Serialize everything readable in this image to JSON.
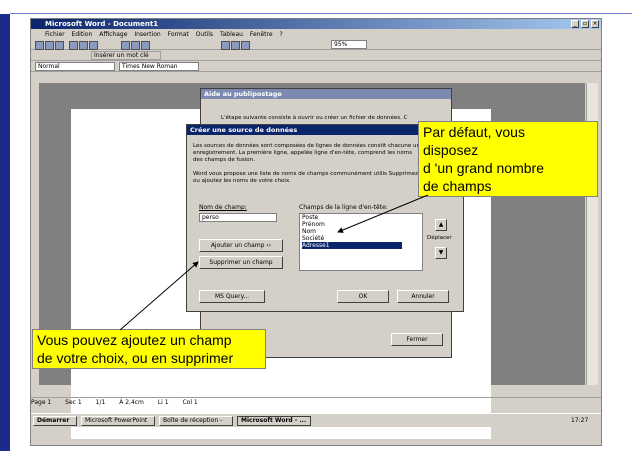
{
  "window": {
    "title": "Microsoft Word - Document1",
    "menu": [
      "Fichier",
      "Edition",
      "Affichage",
      "Insertion",
      "Format",
      "Outils",
      "Tableau",
      "Fenêtre",
      "?"
    ],
    "zoom": "95%",
    "style_value": "Normal",
    "font_value": "Times New Roman",
    "insert_field_label": "Insérer un mot clé"
  },
  "back_dialog": {
    "title": "Aide au publipostage",
    "text": "L'étape suivante consiste à ouvrir ou créer un fichier de données. C",
    "close_label": "Fermer"
  },
  "dialog": {
    "title": "Créer une source de données",
    "para1": "Les sources de données sont composées de lignes de données constit chacune un enregistrement. La première ligne, appelée ligne d'en-tête, comprend les noms des champs de fusion.",
    "para2": "Word vous propose une liste de noms de champs communément utilis Supprimez ou ajoutez les noms de votre choix.",
    "field_label": "Nom de champ:",
    "field_value": "perso",
    "list_label": "Champs de la ligne d'en-tête:",
    "list_items": [
      "Poste",
      "Prénom",
      "Nom",
      "Société",
      "Adresse1"
    ],
    "selected_item": "Adresse1",
    "add_button": "Ajouter un champ ››",
    "remove_button": "Supprimer un champ",
    "move_label": "Déplacer",
    "ms_query_button": "MS Query...",
    "ok_button": "OK",
    "cancel_button": "Annuler"
  },
  "status": [
    "Page 1",
    "Sec 1",
    "1/1",
    "À 2,4cm",
    "Li 1",
    "Col 1"
  ],
  "taskbar": {
    "start": "Démarrer",
    "tasks": [
      "Microsoft PowerPoint",
      "Boîte de réception -",
      "Microsoft Word - ..."
    ],
    "clock": "17:27"
  },
  "callouts": {
    "right": [
      "Par défaut, vous",
      "disposez",
      "d 'un grand nombre",
      "de champs"
    ],
    "left": [
      "Vous pouvez ajoutez un champ",
      "de votre choix, ou en supprimer"
    ]
  },
  "colors": {
    "slide_navy": "#1c2a8a",
    "callout_yellow": "#ffff00",
    "title_blue": "#0a246a"
  }
}
